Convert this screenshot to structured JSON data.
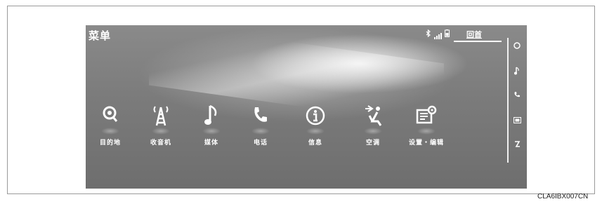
{
  "screen": {
    "title": "菜单",
    "home_label": "回首"
  },
  "status_icons": [
    "bluetooth-icon",
    "signal-icon",
    "phone-battery-icon"
  ],
  "menu_items": [
    {
      "label": "目的地",
      "icon": "destination-search-icon"
    },
    {
      "label": "收音机",
      "icon": "radio-tower-icon"
    },
    {
      "label": "媒体",
      "icon": "music-note-icon"
    },
    {
      "label": "电话",
      "icon": "phone-icon"
    },
    {
      "label": "信息",
      "icon": "info-icon"
    },
    {
      "label": "空调",
      "icon": "climate-seat-icon"
    },
    {
      "label": "设置・编辑",
      "icon": "settings-edit-icon"
    }
  ],
  "sidebar_icons": [
    "navigation-icon",
    "audio-icon",
    "phone-icon",
    "info-screen-icon",
    "climate-icon"
  ],
  "caption": "CLA6IBX007CN"
}
